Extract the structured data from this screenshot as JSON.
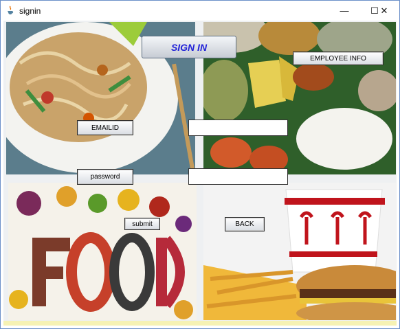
{
  "window": {
    "title": "signin",
    "controls": {
      "minimize": "—",
      "maximize": "☐",
      "close": "✕"
    }
  },
  "form": {
    "heading": "SIGN IN",
    "employee_info": "EMPLOYEE INFO",
    "email_label": "EMAILID",
    "email_value": "",
    "password_label": "password",
    "password_value": "",
    "submit": "submit",
    "back": "BACK"
  },
  "colors": {
    "heading": "#2222d8",
    "statusbar": "#f6f2b4"
  }
}
